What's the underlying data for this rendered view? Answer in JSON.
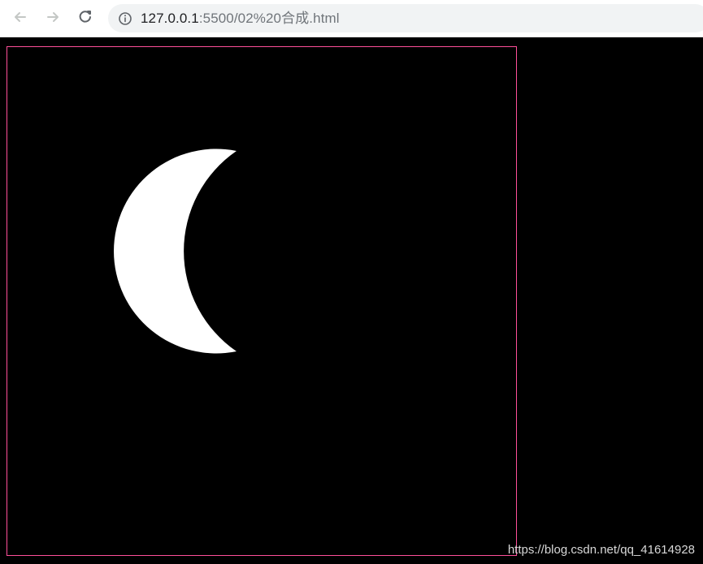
{
  "browser": {
    "nav": {
      "back_icon": "arrow-left-icon",
      "forward_icon": "arrow-right-icon",
      "reload_icon": "reload-icon"
    },
    "omnibox": {
      "security_icon": "info-icon",
      "url_host": "127.0.0.1",
      "url_path": ":5500/02%20合成.html"
    }
  },
  "canvas": {
    "border_color": "#ff4f9a",
    "background": "#000000",
    "moon_color": "#ffffff"
  },
  "footer": {
    "watermark": "https://blog.csdn.net/qq_41614928"
  }
}
